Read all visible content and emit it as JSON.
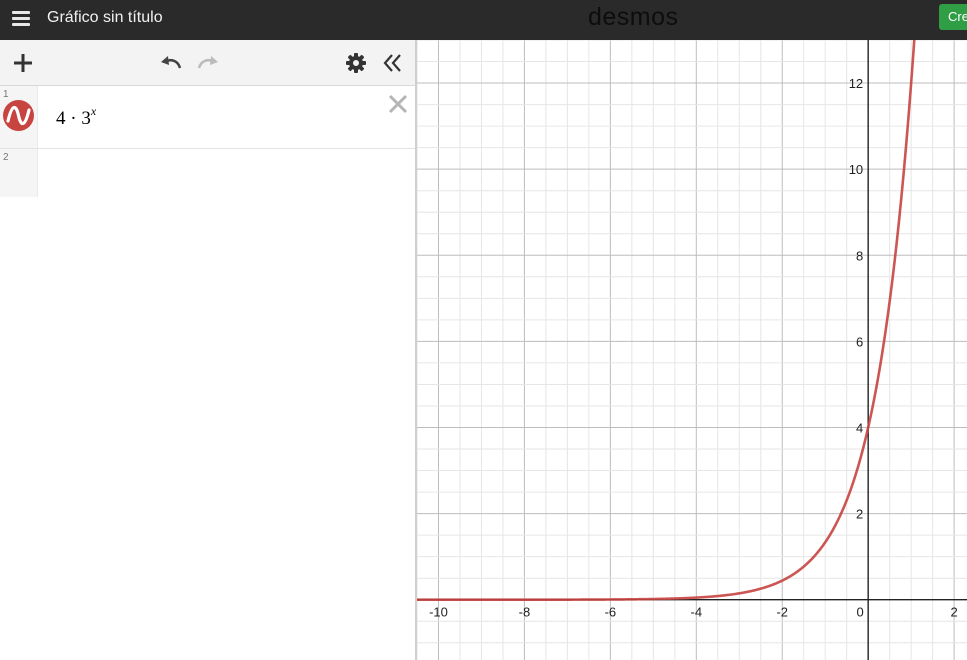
{
  "header": {
    "title": "Gráfico sin título",
    "logo": "desmos",
    "create_label": "Cre"
  },
  "toolbar": {
    "icons": [
      "plus-icon",
      "undo-icon",
      "redo-icon",
      "gear-icon",
      "collapse-icon"
    ]
  },
  "expressions": [
    {
      "index": "1",
      "base_text": "4 · 3",
      "exponent": "x",
      "color": "#c74440"
    },
    {
      "index": "2"
    }
  ],
  "graph": {
    "x_ticks": [
      "-10",
      "-8",
      "-6",
      "-4",
      "-2",
      "0",
      "2"
    ],
    "y_ticks": [
      "2",
      "4",
      "6",
      "8",
      "10",
      "12"
    ],
    "curve_color": "#c74440"
  },
  "chart_data": {
    "type": "line",
    "series": [
      {
        "name": "",
        "function": "4·3^x",
        "color": "#c74440"
      }
    ],
    "xlim": [
      -10.5,
      2.3
    ],
    "ylim": [
      -1.4,
      13
    ],
    "x_tick_labels": [
      "-10",
      "-8",
      "-6",
      "-4",
      "-2",
      "0",
      "2"
    ],
    "y_tick_labels": [
      "2",
      "4",
      "6",
      "8",
      "10",
      "12"
    ],
    "major_grid_step": 2,
    "minor_grid_step": 0.5,
    "grid": true
  }
}
